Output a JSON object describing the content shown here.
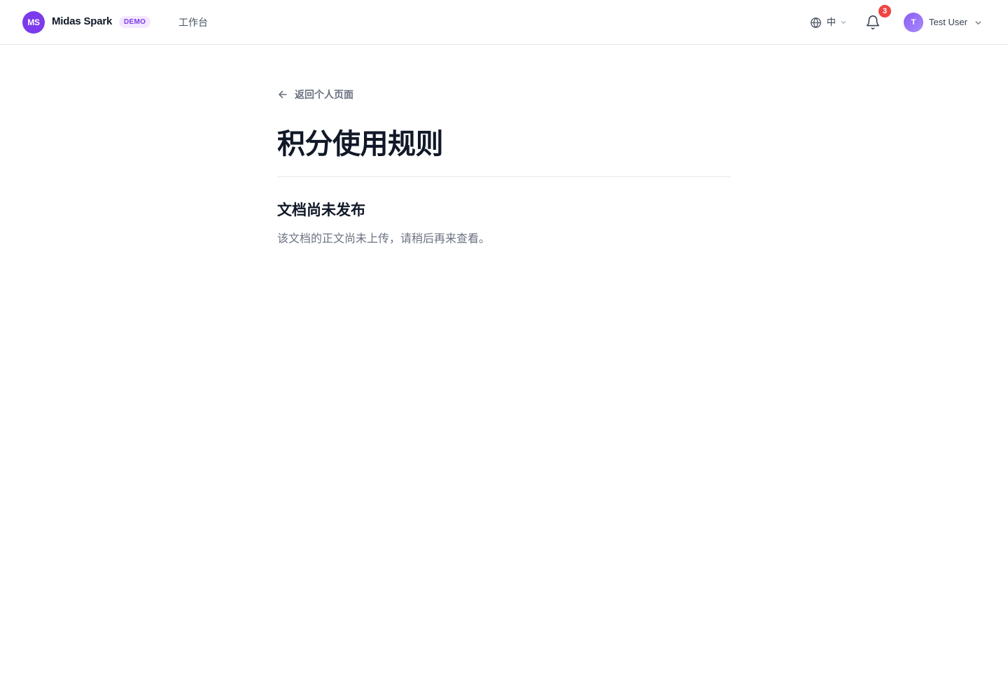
{
  "header": {
    "logo_initials": "MS",
    "brand_name": "Midas Spark",
    "demo_tag": "DEMO",
    "nav": {
      "workbench_label": "工作台"
    },
    "language": {
      "label": "中"
    },
    "notifications": {
      "count": "3"
    },
    "user": {
      "avatar_initial": "T",
      "name": "Test User"
    }
  },
  "main": {
    "back_label": "返回个人页面",
    "title": "积分使用规则",
    "section": {
      "heading": "文档尚未发布",
      "body": "该文档的正文尚未上传，请稍后再来查看。"
    }
  },
  "colors": {
    "accent": "#7c3aed",
    "accent_light": "#f3e8ff",
    "badge_red": "#ef4444",
    "text_primary": "#111827",
    "text_muted": "#6b7280",
    "border": "#e5e7eb"
  },
  "icons": {
    "language": "globe-icon",
    "notifications": "bell-icon",
    "back": "arrow-left-icon",
    "dropdown": "chevron-down-icon"
  }
}
